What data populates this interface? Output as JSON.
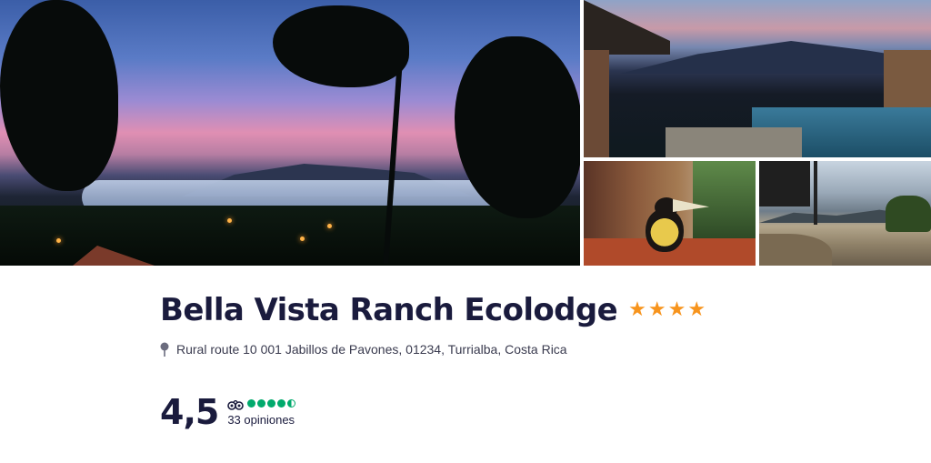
{
  "gallery": {
    "photos": [
      {
        "name": "sunset-panorama-photo"
      },
      {
        "name": "pool-dusk-photo"
      },
      {
        "name": "toucan-photo"
      },
      {
        "name": "infinity-pool-photo"
      }
    ]
  },
  "hotel": {
    "name": "Bella Vista Ranch Ecolodge",
    "star_rating": 4,
    "star_icon": "star-icon",
    "star_color": "#f7941d",
    "address_icon": "map-pin-icon",
    "address": "Rural route 10 001 Jabillos de Pavones, 01234, Turrialba, Costa Rica"
  },
  "rating": {
    "score": "4,5",
    "bubble_rating": 4.5,
    "bubble_color": "#00aa6c",
    "source_icon": "tripadvisor-owl-icon",
    "reviews_label": "33 opiniones"
  },
  "colors": {
    "title": "#1a1b3d",
    "text": "#3a3b4f"
  }
}
